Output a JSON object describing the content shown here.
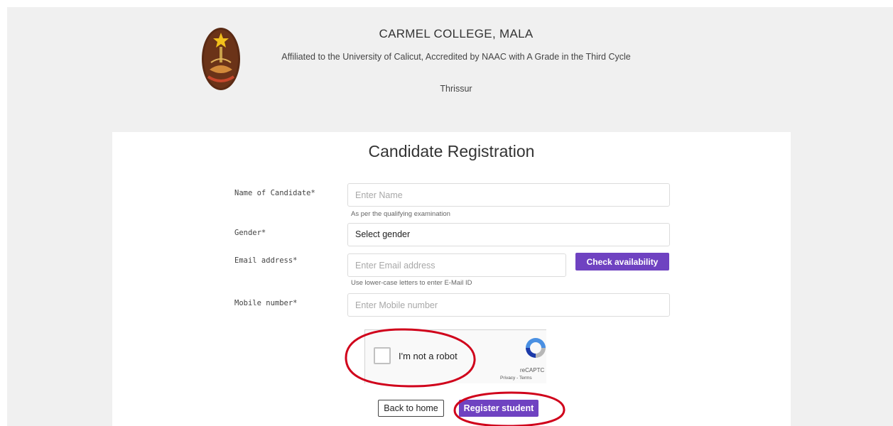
{
  "header": {
    "college_name": "CARMEL COLLEGE, MALA",
    "affiliation": "Affiliated to the University of Calicut, Accredited by NAAC with A Grade in the Third Cycle",
    "city": "Thrissur",
    "logo_icon": "college-emblem-icon"
  },
  "form": {
    "title": "Candidate Registration",
    "name": {
      "label": "Name of Candidate*",
      "placeholder": "Enter Name",
      "value": "",
      "help": "As per the qualifying examination"
    },
    "gender": {
      "label": "Gender*",
      "selected": "Select gender"
    },
    "email": {
      "label": "Email address*",
      "placeholder": "Enter Email address",
      "value": "",
      "help": "Use lower-case letters to enter E-Mail ID",
      "check_button": "Check availability"
    },
    "mobile": {
      "label": "Mobile number*",
      "placeholder": "Enter Mobile number",
      "value": ""
    }
  },
  "recaptcha": {
    "label": "I'm not a robot",
    "brand": "reCAPTC",
    "links": "Privacy - Terms",
    "checked": false
  },
  "actions": {
    "back": "Back to home",
    "register": "Register student"
  },
  "colors": {
    "accent": "#6f42c1",
    "annotation": "#d0021b",
    "background": "#f0f0f0"
  }
}
